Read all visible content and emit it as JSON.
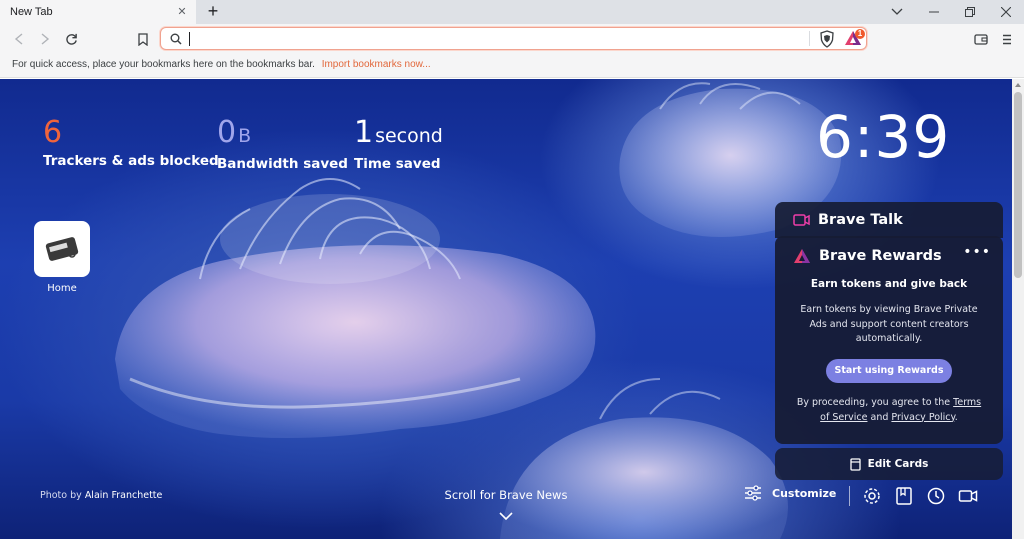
{
  "tab": {
    "title": "New Tab",
    "close_glyph": "✕",
    "new_tab_glyph": "+"
  },
  "window": {
    "minimize_icon": "minimize-icon",
    "restore_icon": "restore-icon",
    "close_icon": "close-icon",
    "tab_list_icon": "chevron-down-icon"
  },
  "toolbar": {
    "back_icon": "back-icon",
    "forward_icon": "forward-icon",
    "reload_icon": "reload-icon",
    "bookmark_icon": "bookmark-icon",
    "url_value": "",
    "url_placeholder": "",
    "rewards_badge": "1",
    "wallet_icon": "wallet-icon",
    "menu_icon": "menu-icon"
  },
  "bookmarks_bar": {
    "message": "For quick access, place your bookmarks here on the bookmarks bar.",
    "import_link": "Import bookmarks now..."
  },
  "stats": [
    {
      "value": "6",
      "unit": "",
      "label": "Trackers & ads blocked",
      "color": "#f0643c"
    },
    {
      "value": "0",
      "unit": "B",
      "label": "Bandwidth saved",
      "color": "#a0a5eb"
    },
    {
      "value": "1",
      "unit": "second",
      "label": "Time saved",
      "color": "#ffffff"
    }
  ],
  "clock": "6:39",
  "top_sites": [
    {
      "label": "Home"
    }
  ],
  "brave_talk": {
    "title": "Brave Talk"
  },
  "brave_rewards": {
    "title": "Brave Rewards",
    "more": "•••",
    "subtitle": "Earn tokens and give back",
    "description": "Earn tokens by viewing Brave Private Ads and support content creators automatically.",
    "button": "Start using Rewards",
    "legal_prefix": "By proceeding, you agree to the",
    "terms": "Terms of Service",
    "legal_and": "and",
    "privacy": "Privacy Policy",
    "legal_suffix": "."
  },
  "edit_cards": "Edit Cards",
  "footer": {
    "photo_by": "Photo by",
    "photographer": "Alain Franchette",
    "scroll_news": "Scroll for Brave News",
    "customize": "Customize"
  },
  "colors": {
    "accent": "#f0643c",
    "rewards_button": "#7c80e2",
    "card_bg": "#161c34"
  }
}
